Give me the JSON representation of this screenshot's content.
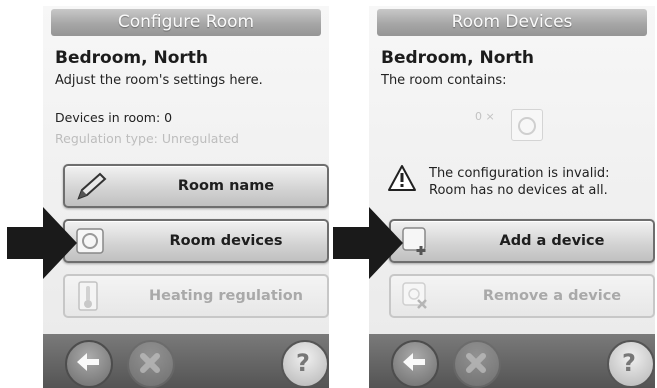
{
  "left_screen": {
    "title": "Configure Room",
    "room_name": "Bedroom, North",
    "subtitle": "Adjust the room's settings here.",
    "devices_info": "Devices in room: 0",
    "regulation_info": "Regulation type: Unregulated",
    "buttons": [
      {
        "label": "Room name",
        "icon": "pencil-icon",
        "enabled": true
      },
      {
        "label": "Room devices",
        "icon": "device-icon",
        "enabled": true
      },
      {
        "label": "Heating regulation",
        "icon": "thermometer-icon",
        "enabled": false
      }
    ]
  },
  "right_screen": {
    "title": "Room Devices",
    "room_name": "Bedroom, North",
    "subtitle": "The room contains:",
    "device_count": "0 ×",
    "warning_line1": "The configuration is invalid:",
    "warning_line2": "Room has no devices at all.",
    "buttons": [
      {
        "label": "Add a device",
        "icon": "add-device-icon",
        "enabled": true
      },
      {
        "label": "Remove a device",
        "icon": "remove-device-icon",
        "enabled": false
      }
    ]
  },
  "bottom_bar": {
    "icons": [
      "back-arrow-icon",
      "cancel-icon",
      "help-icon"
    ],
    "help_glyph": "?"
  },
  "colors": {
    "pointer_arrow": "#1a1a1a",
    "title_bar": "#a6a6a6",
    "bottom_bar": "#5e5e5e"
  }
}
